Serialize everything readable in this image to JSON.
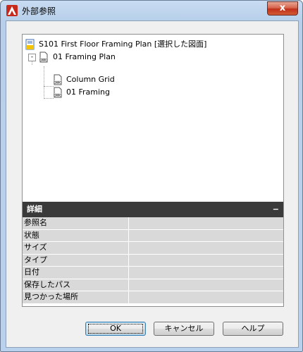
{
  "window": {
    "title": "外部参照",
    "close_glyph": "x"
  },
  "tree": {
    "items": [
      {
        "label": "S101 First Floor Framing Plan [選択した図面]",
        "icon": "drawing-root-icon"
      },
      {
        "label": "01 Framing Plan",
        "icon": "dwg-file-icon",
        "expander": "-"
      },
      {
        "label": "Column Grid",
        "icon": "dwg-file-icon"
      },
      {
        "label": "01 Framing",
        "icon": "dwg-file-icon"
      }
    ]
  },
  "details": {
    "header": "詳細",
    "collapse_glyph": "−",
    "properties": [
      {
        "name": "参照名",
        "value": ""
      },
      {
        "name": "状態",
        "value": ""
      },
      {
        "name": "サイズ",
        "value": ""
      },
      {
        "name": "タイプ",
        "value": ""
      },
      {
        "name": "日付",
        "value": ""
      },
      {
        "name": "保存したパス",
        "value": ""
      },
      {
        "name": "見つかった場所",
        "value": ""
      }
    ]
  },
  "buttons": {
    "ok": "OK",
    "cancel": "キャンセル",
    "help": "ヘルプ"
  },
  "colors": {
    "accent": "#c0311a",
    "details_header": "#3a3a3a",
    "prop_bg": "#d9d9d9"
  }
}
